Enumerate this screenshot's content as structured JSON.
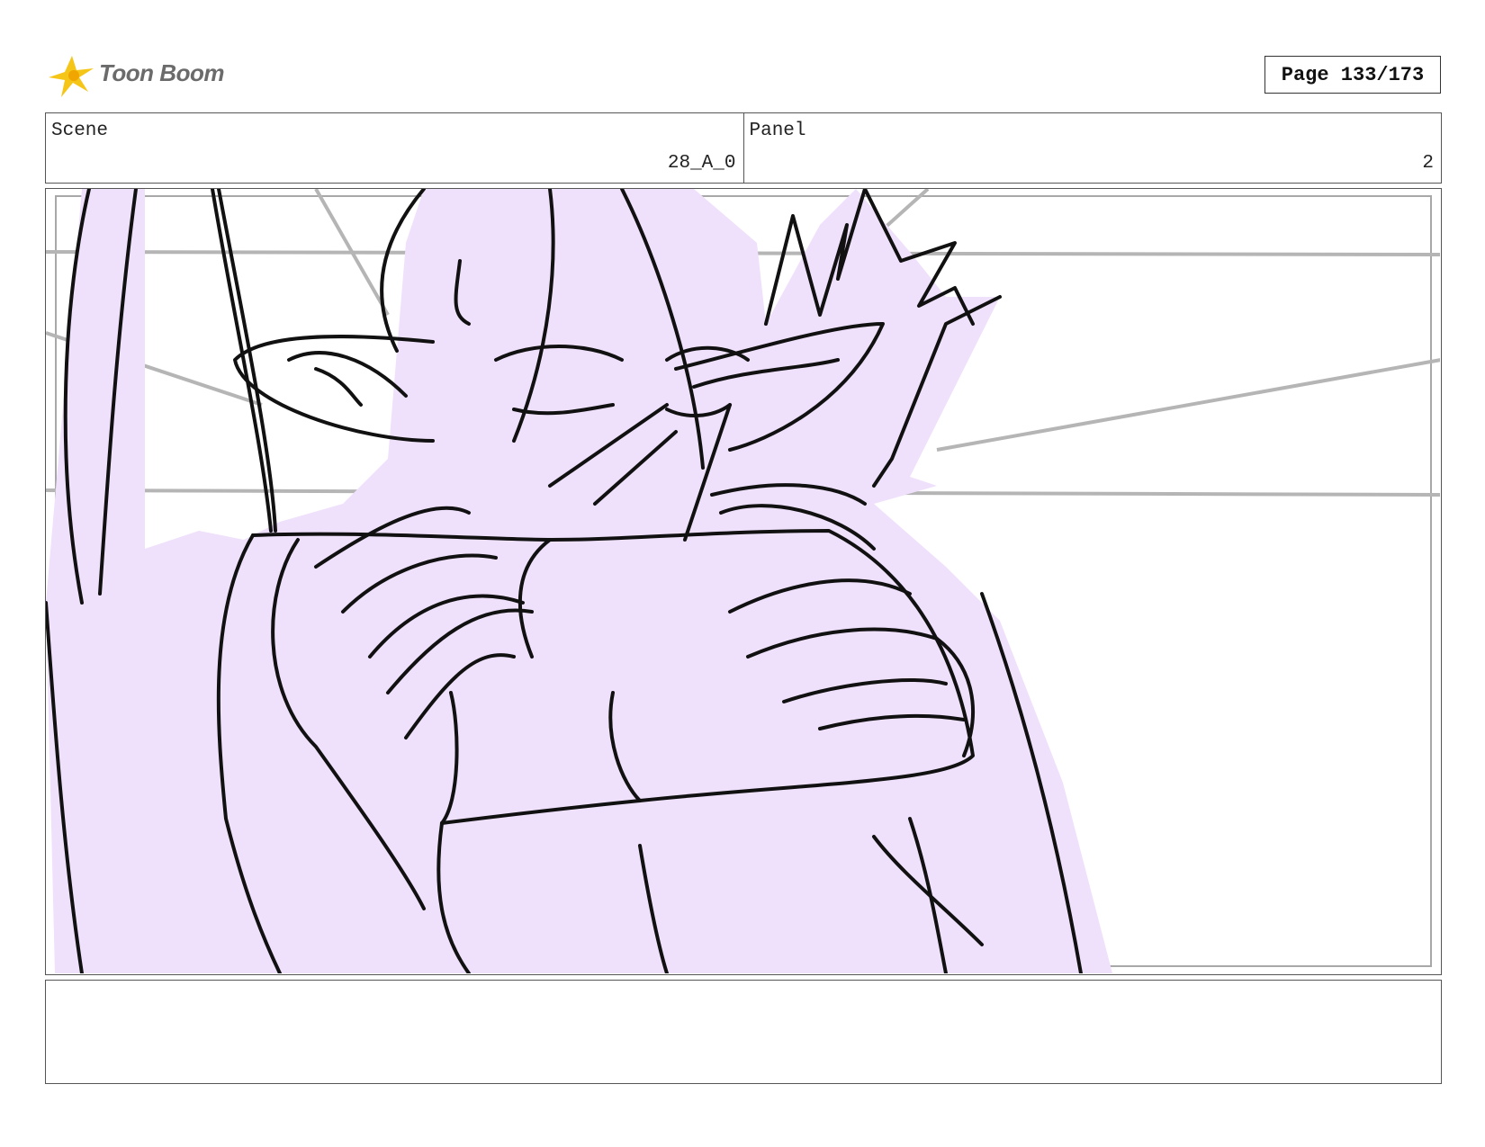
{
  "header": {
    "logo_text": "Toon Boom",
    "page_label": "Page 133/173"
  },
  "scene": {
    "label": "Scene",
    "value": "28_A_0"
  },
  "panel": {
    "label": "Panel",
    "value": "2"
  },
  "artwork": {
    "description_icon": "storyboard-sketch-icon",
    "fill_color": "#efe0fb",
    "line_color": "#111111",
    "guide_color": "#b5b5b5",
    "logo_color": "#f5c518"
  },
  "notes": {
    "text": ""
  }
}
